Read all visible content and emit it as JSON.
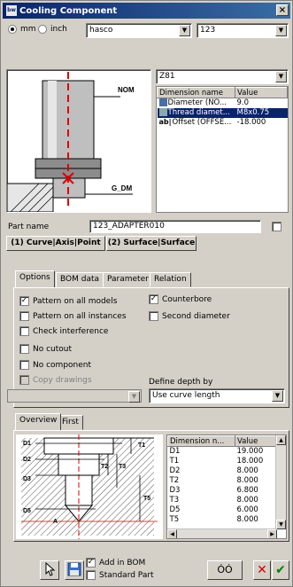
{
  "window": {
    "title": "Cooling Component",
    "close_glyph": "×",
    "icon_text": "bw"
  },
  "units": {
    "mm_label": "mm",
    "inch_label": "inch",
    "selected": "mm"
  },
  "supplier": {
    "value": "hasco"
  },
  "catalog": {
    "value": "123"
  },
  "preview_labels": {
    "nom": "NOM",
    "gdm": "G_DM"
  },
  "variant": {
    "value": "Z81"
  },
  "dim_table": {
    "headers": [
      "Dimension name",
      "Value"
    ],
    "rows": [
      {
        "icon": "dim-icon",
        "name": "Diameter (NO...",
        "value": "9.0",
        "selected": false
      },
      {
        "icon": "thread-icon",
        "name": "Thread diamet...",
        "value": "M8x0.75",
        "selected": true
      },
      {
        "icon": "text-icon",
        "name": "Offset (OFFSE...",
        "value": "-18.000",
        "selected": false
      }
    ]
  },
  "part_name": {
    "label": "Part name",
    "value": "123_ADAPTER010"
  },
  "ref_buttons": {
    "curve": "(1) Curve|Axis|Point",
    "surface": "(2) Surface|Surface"
  },
  "tabs": [
    "Options",
    "BOM data",
    "Parameter",
    "Relation"
  ],
  "options": {
    "pattern_all_models": "Pattern on all models",
    "pattern_all_instances": "Pattern on all instances",
    "check_interference": "Check interference",
    "no_cutout": "No cutout",
    "no_component": "No component",
    "copy_drawings": "Copy drawings",
    "counterbore": "Counterbore",
    "second_diameter": "Second diameter",
    "define_depth_label": "Define depth by",
    "depth_value": "Use curve length"
  },
  "bottom_tabs": [
    "Overview",
    "First"
  ],
  "drawing_labels": [
    "D1",
    "T1",
    "D2",
    "T2",
    "T3",
    "D3",
    "T5",
    "D5",
    "A"
  ],
  "param_table": {
    "headers": [
      "Dimension n...",
      "Value"
    ],
    "rows": [
      [
        "D1",
        "19.000"
      ],
      [
        "T1",
        "18.000"
      ],
      [
        "D2",
        "8.000"
      ],
      [
        "T2",
        "8.000"
      ],
      [
        "D3",
        "6.800"
      ],
      [
        "T3",
        "8.000"
      ],
      [
        "D5",
        "6.000"
      ],
      [
        "T5",
        "8.000"
      ]
    ]
  },
  "footer": {
    "add_bom": "Add in BOM",
    "standard_part": "Standard Part",
    "glasses_glyph": "ᅇ",
    "cancel_glyph": "✕",
    "ok_glyph": "✔"
  },
  "colors": {
    "title_bar": "#0a246a",
    "selection": "#0a246a",
    "cancel": "#d40000",
    "ok": "#008000",
    "centerline": "#e00000"
  }
}
